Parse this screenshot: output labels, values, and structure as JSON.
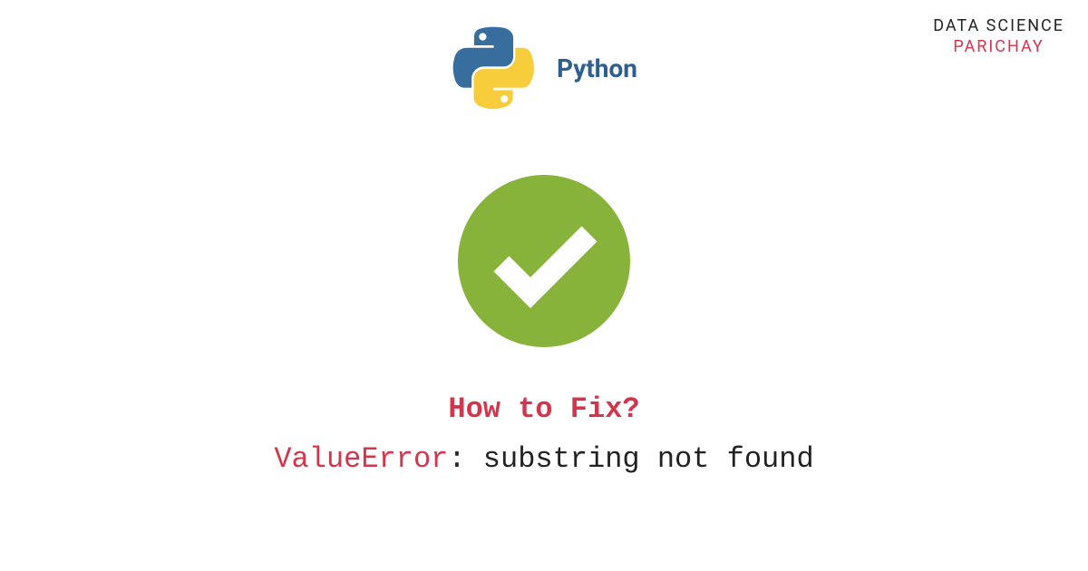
{
  "watermark": {
    "line1": "DATA SCIENCE",
    "line2": "PARICHAY"
  },
  "header": {
    "label": "Python"
  },
  "colors": {
    "accent_red": "#d4354c",
    "python_blue": "#386e9e",
    "python_yellow": "#f7cd3c",
    "check_green": "#88b33a"
  },
  "footer": {
    "question": "How to Fix?",
    "error_type": "ValueError",
    "error_msg": ": substring not found"
  }
}
